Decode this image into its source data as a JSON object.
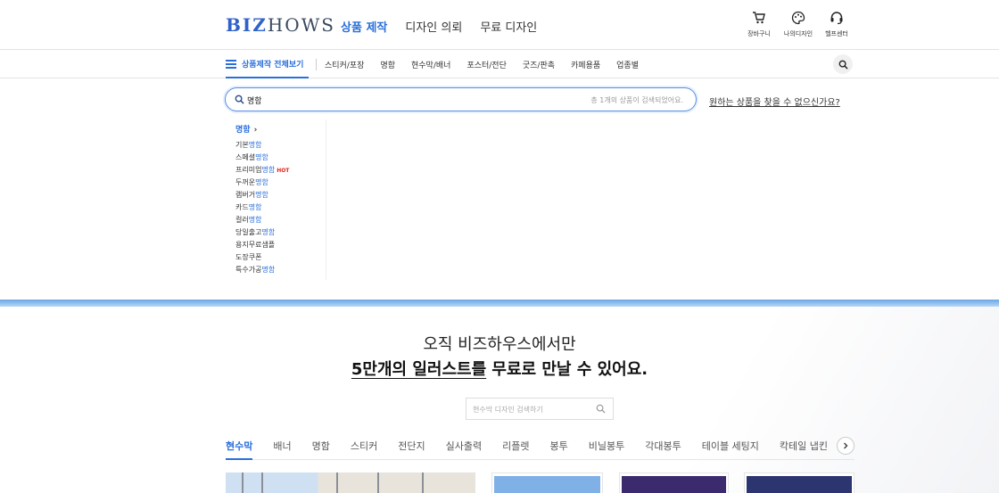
{
  "header": {
    "logo_a": "BIZ",
    "logo_b": "HOWS",
    "nav": [
      "상품 제작",
      "디자인 의뢰",
      "무료 디자인"
    ],
    "utils": [
      {
        "label": "장바구니",
        "icon": "cart-icon"
      },
      {
        "label": "나의디자인",
        "icon": "palette-icon"
      },
      {
        "label": "헬프센터",
        "icon": "headset-icon"
      }
    ]
  },
  "catbar": {
    "all_label": "상품제작 전체보기",
    "items": [
      "스티커/포장",
      "명함",
      "현수막/배너",
      "포스터/전단",
      "굿즈/판촉",
      "카페용품",
      "업종별"
    ]
  },
  "search": {
    "query": "명함",
    "result_count": "총 1개의 상품이 검색되었어요.",
    "help_link": "원하는 상품을 찾을 수 없으신가요?"
  },
  "suggestions": {
    "category": "명함",
    "items": [
      {
        "pre": "기본",
        "hl": "명함",
        "hot": ""
      },
      {
        "pre": "스페셜",
        "hl": "명함",
        "hot": ""
      },
      {
        "pre": "프리미엄",
        "hl": "명함",
        "hot": "HOT"
      },
      {
        "pre": "두꺼운",
        "hl": "명함",
        "hot": ""
      },
      {
        "pre": "램버거",
        "hl": "명함",
        "hot": ""
      },
      {
        "pre": "카드",
        "hl": "명함",
        "hot": ""
      },
      {
        "pre": "컬러",
        "hl": "명함",
        "hot": ""
      },
      {
        "pre": "당일출고",
        "hl": "명함",
        "hot": ""
      },
      {
        "pre": "용지무료샘플",
        "hl": "",
        "hot": ""
      },
      {
        "pre": "도장쿠폰",
        "hl": "",
        "hot": ""
      },
      {
        "pre": "특수가공",
        "hl": "명함",
        "hot": ""
      }
    ]
  },
  "promo": {
    "line1": "오직 비즈하우스에서만",
    "line2_em": "5만개의 일러스트를",
    "line2_rest": " 무료로 만날 수 있어요.",
    "search_placeholder": "현수막 디자인 검색하기"
  },
  "tabs": [
    "현수막",
    "배너",
    "명함",
    "스티커",
    "전단지",
    "실사출력",
    "리플렛",
    "봉투",
    "비닐봉투",
    "각대봉투",
    "테이블 세팅지",
    "칵테일 냅킨"
  ],
  "colors": {
    "accent": "#2a6fdb",
    "hot": "#e0261b"
  }
}
